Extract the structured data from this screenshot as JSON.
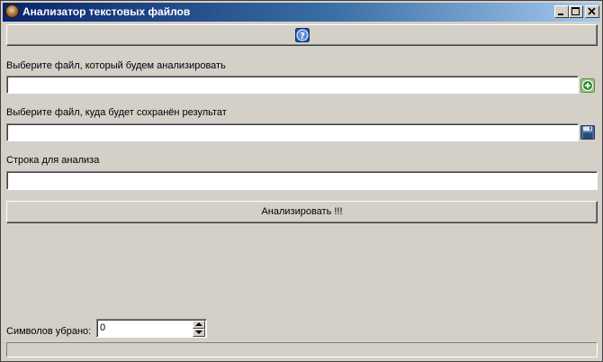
{
  "window": {
    "title": "Анализатор текстовых файлов"
  },
  "help_button": {
    "icon": "help-icon"
  },
  "source_file": {
    "label": "Выберите файл, который будем анализировать",
    "value": "",
    "icon": "add-file-icon"
  },
  "result_file": {
    "label": "Выберите файл, куда будет сохранён результат",
    "value": "",
    "icon": "save-icon"
  },
  "analysis_string": {
    "label": "Строка для анализа",
    "value": ""
  },
  "analyze_button": {
    "label": "Анализировать !!!"
  },
  "removed_chars": {
    "label": "Символов убрано:",
    "value": "0"
  },
  "progress": {
    "fraction": 0
  },
  "colors": {
    "title_gradient_start": "#0a246a",
    "title_gradient_end": "#a6caf0",
    "window_bg": "#d4d0c8"
  }
}
